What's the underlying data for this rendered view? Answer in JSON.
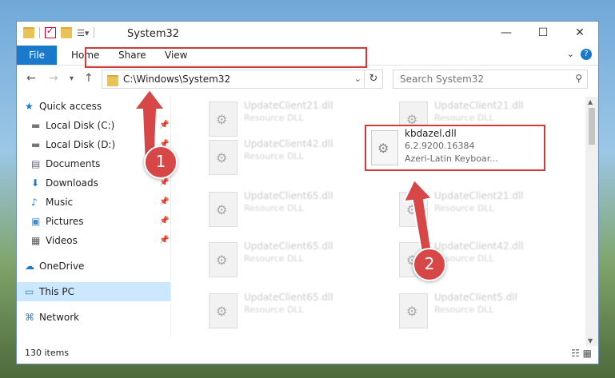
{
  "window": {
    "title": "System32",
    "controls": {
      "minimize": "—",
      "maximize": "☐",
      "close": "✕"
    }
  },
  "ribbon": {
    "tabs": [
      "File",
      "Home",
      "Share",
      "View"
    ],
    "help": "?"
  },
  "address": {
    "path": "C:\\Windows\\System32",
    "search_placeholder": "Search System32"
  },
  "sidebar": {
    "items": [
      {
        "label": "Quick access",
        "icon": "star-icon",
        "pinned": false
      },
      {
        "label": "Local Disk (C:)",
        "icon": "disk-icon",
        "pinned": true
      },
      {
        "label": "Local Disk (D:)",
        "icon": "disk-icon",
        "pinned": true
      },
      {
        "label": "Documents",
        "icon": "documents-icon",
        "pinned": true
      },
      {
        "label": "Downloads",
        "icon": "download-icon",
        "pinned": true
      },
      {
        "label": "Music",
        "icon": "music-icon",
        "pinned": true
      },
      {
        "label": "Pictures",
        "icon": "pictures-icon",
        "pinned": true
      },
      {
        "label": "Videos",
        "icon": "videos-icon",
        "pinned": true
      },
      {
        "label": "OneDrive",
        "icon": "cloud-icon",
        "pinned": false
      },
      {
        "label": "This PC",
        "icon": "computer-icon",
        "pinned": false,
        "selected": true
      },
      {
        "label": "Network",
        "icon": "network-icon",
        "pinned": false
      }
    ]
  },
  "files": {
    "left": [
      {
        "name": "UpdateClient21.dll",
        "desc": "Resource DLL"
      },
      {
        "name": "UpdateClient42.dll",
        "desc": "Resource DLL"
      },
      {
        "name": "UpdateClient65.dll",
        "desc": "Resource DLL"
      },
      {
        "name": "UpdateClient65.dll",
        "desc": "Resource DLL"
      },
      {
        "name": "UpdateClient65.dll",
        "desc": "Resource DLL"
      }
    ],
    "right": [
      {
        "name": "UpdateClient21.dll",
        "desc": "Resource DLL"
      },
      {
        "name": "UpdateClient21.dll",
        "desc": "Resource DLL"
      },
      {
        "name": "UpdateClient42.dll",
        "desc": "Resource DLL"
      },
      {
        "name": "UpdateClient5.dll",
        "desc": "Resource DLL"
      }
    ],
    "highlighted": {
      "name": "kbdazel.dll",
      "version": "6.2.9200.16384",
      "desc": "Azeri-Latin Keyboar..."
    }
  },
  "status": {
    "item_count": "130 items"
  },
  "annotations": {
    "step1": "1",
    "step2": "2",
    "color": "#d84747"
  }
}
